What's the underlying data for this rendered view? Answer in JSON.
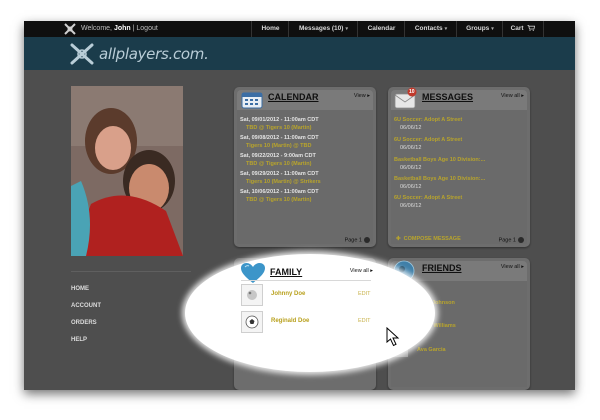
{
  "topbar": {
    "welcome_prefix": "Welcome, ",
    "user": "John",
    "separator": " | ",
    "logout": "Logout",
    "nav": [
      {
        "label": "Home",
        "caret": false
      },
      {
        "label": "Messages (10)",
        "caret": true
      },
      {
        "label": "Calendar",
        "caret": false
      },
      {
        "label": "Contacts",
        "caret": true
      },
      {
        "label": "Groups",
        "caret": true
      },
      {
        "label": "Cart",
        "caret": false
      }
    ]
  },
  "header": {
    "brand": "allplayers.com."
  },
  "sidenav": [
    "HOME",
    "ACCOUNT",
    "ORDERS",
    "HELP"
  ],
  "calendar": {
    "title": "CALENDAR",
    "view": "View ▸",
    "events": [
      {
        "date": "Sat, 09/01/2012 - 11:00am CDT",
        "match": "TBD @ Tigers 10 (Martin)"
      },
      {
        "date": "Sat, 09/08/2012 - 11:00am CDT",
        "match": "Tigers 10 (Martin) @ TBD"
      },
      {
        "date": "Sat, 09/22/2012 - 9:00am CDT",
        "match": "TBD @ Tigers 10 (Martin)"
      },
      {
        "date": "Sat, 09/29/2012 - 11:00am CDT",
        "match": "Tigers 10 (Martin) @ Strikers"
      },
      {
        "date": "Sat, 10/06/2012 - 11:00am CDT",
        "match": "TBD @ Tigers 10 (Martin)"
      }
    ],
    "page": "Page 1"
  },
  "messages": {
    "title": "MESSAGES",
    "badge": "10",
    "view": "View all ▸",
    "items": [
      {
        "title": "6U Soccer: Adopt A Street",
        "date": "06/06/12"
      },
      {
        "title": "6U Soccer: Adopt A Street",
        "date": "06/06/12"
      },
      {
        "title": "Basketball Boys Age 10 Division:...",
        "date": "06/06/12"
      },
      {
        "title": "Basketball Boys Age 10 Division:...",
        "date": "06/06/12"
      },
      {
        "title": "6U Soccer: Adopt A Street",
        "date": "06/06/12"
      }
    ],
    "compose": "COMPOSE MESSAGE",
    "page": "Page 1"
  },
  "family": {
    "title": "FAMILY",
    "view": "View all ▸",
    "members": [
      {
        "name": "Johnny Doe",
        "edit": "EDIT"
      },
      {
        "name": "Reginald Doe",
        "edit": "EDIT"
      }
    ]
  },
  "friends": {
    "title": "FRIENDS",
    "view": "View all ▸",
    "items": [
      "Sofia Johnson",
      "David Williams",
      "Ava Garcia"
    ]
  },
  "colors": {
    "topbar": "#0f0f0f",
    "header": "#1b3c4b",
    "page": "#4e4e4e",
    "link_gold": "#b8a42c",
    "calendar_icon": "#3b6ea5",
    "messages_badge": "#c0392b"
  },
  "icons": [
    "allplayers-logo-icon",
    "cart-icon",
    "calendar-icon",
    "envelope-icon",
    "heart-icon",
    "friends-globe-icon",
    "next-page-icon",
    "compose-plus-icon",
    "mouse-cursor-icon"
  ]
}
